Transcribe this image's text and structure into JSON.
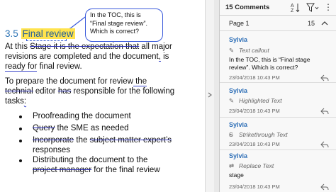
{
  "document": {
    "heading_number": "3.5",
    "heading_title": "Final review",
    "callout_text": "In the TOC, this is “Final stage review”. Which is correct?",
    "para1": {
      "l1_a": "At this ",
      "l1_strike": "Stage it is the expectation that",
      "l1_b": " all major",
      "l2_a": "revisions are completed and the document",
      "l2_mark": ",",
      "l2_b": " is",
      "l3_a": "ready for",
      "l3_b": " final review."
    },
    "para2": {
      "l1": "To prepare the document for review",
      "l1_mark": " the",
      "l2_strike": "technial",
      "l2_a": " editor ",
      "l2_strike2": "has",
      "l2_b": " responsible for the following",
      "l3": "tasks",
      "l3_mark": ":"
    },
    "bullets": {
      "b1": "Proofreading the document",
      "b2_strike": "Query",
      "b2_rest": " the SME as needed",
      "b3_strike": "Incorporate",
      "b3_mid": " the ",
      "b3_strike2": "subject matter expert’s",
      "b3_cont": "responses",
      "b4_a": "Distributing the document to the",
      "b4_strike": "project manager",
      "b4_b": " for the final review"
    }
  },
  "panel": {
    "comment_count": "15 Comments",
    "page_label": "Page 1",
    "page_count": "15",
    "comments": [
      {
        "author": "Sylvia",
        "type": "Text callout",
        "body": "In the TOC, this is “Final stage review”. Which is correct?",
        "timestamp": "23/04/2018  10:43 PM"
      },
      {
        "author": "Sylvia",
        "type": "Highlighted Text",
        "body": "",
        "timestamp": "23/04/2018  10:43 PM"
      },
      {
        "author": "Sylvia",
        "type": "Strikethrough Text",
        "body": "",
        "timestamp": "23/04/2018  10:43 PM"
      },
      {
        "author": "Sylvia",
        "type": "Replace Text",
        "body": "stage",
        "timestamp": "23/04/2018  10:43 PM"
      }
    ]
  },
  "colors": {
    "heading_blue": "#2e74b5",
    "highlight_yellow": "#ffe34d",
    "author_blue": "#2e6fb7",
    "markup_blue": "#2a2fb5"
  }
}
